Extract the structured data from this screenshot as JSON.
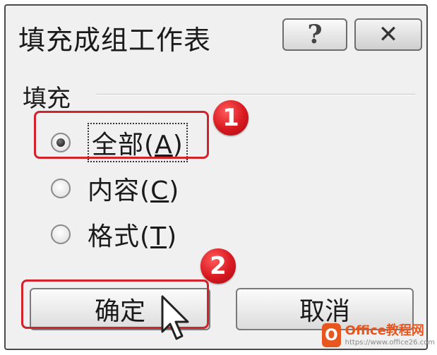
{
  "dialog": {
    "title": "填充成组工作表",
    "help_glyph": "?",
    "close_glyph": "✕"
  },
  "fill_group": {
    "label": "填充",
    "options": [
      {
        "label": "全部",
        "mnemonic": "A",
        "selected": true
      },
      {
        "label": "内容",
        "mnemonic": "C",
        "selected": false
      },
      {
        "label": "格式",
        "mnemonic": "T",
        "selected": false
      }
    ]
  },
  "buttons": {
    "ok_label": "确定",
    "cancel_label": "取消"
  },
  "annotations": {
    "step1": "1",
    "step2": "2",
    "highlight_color": "#d3222c"
  },
  "watermark": {
    "logo_letter": "O",
    "title": "Office教程网",
    "subtitle": "https://www.office26.com"
  }
}
